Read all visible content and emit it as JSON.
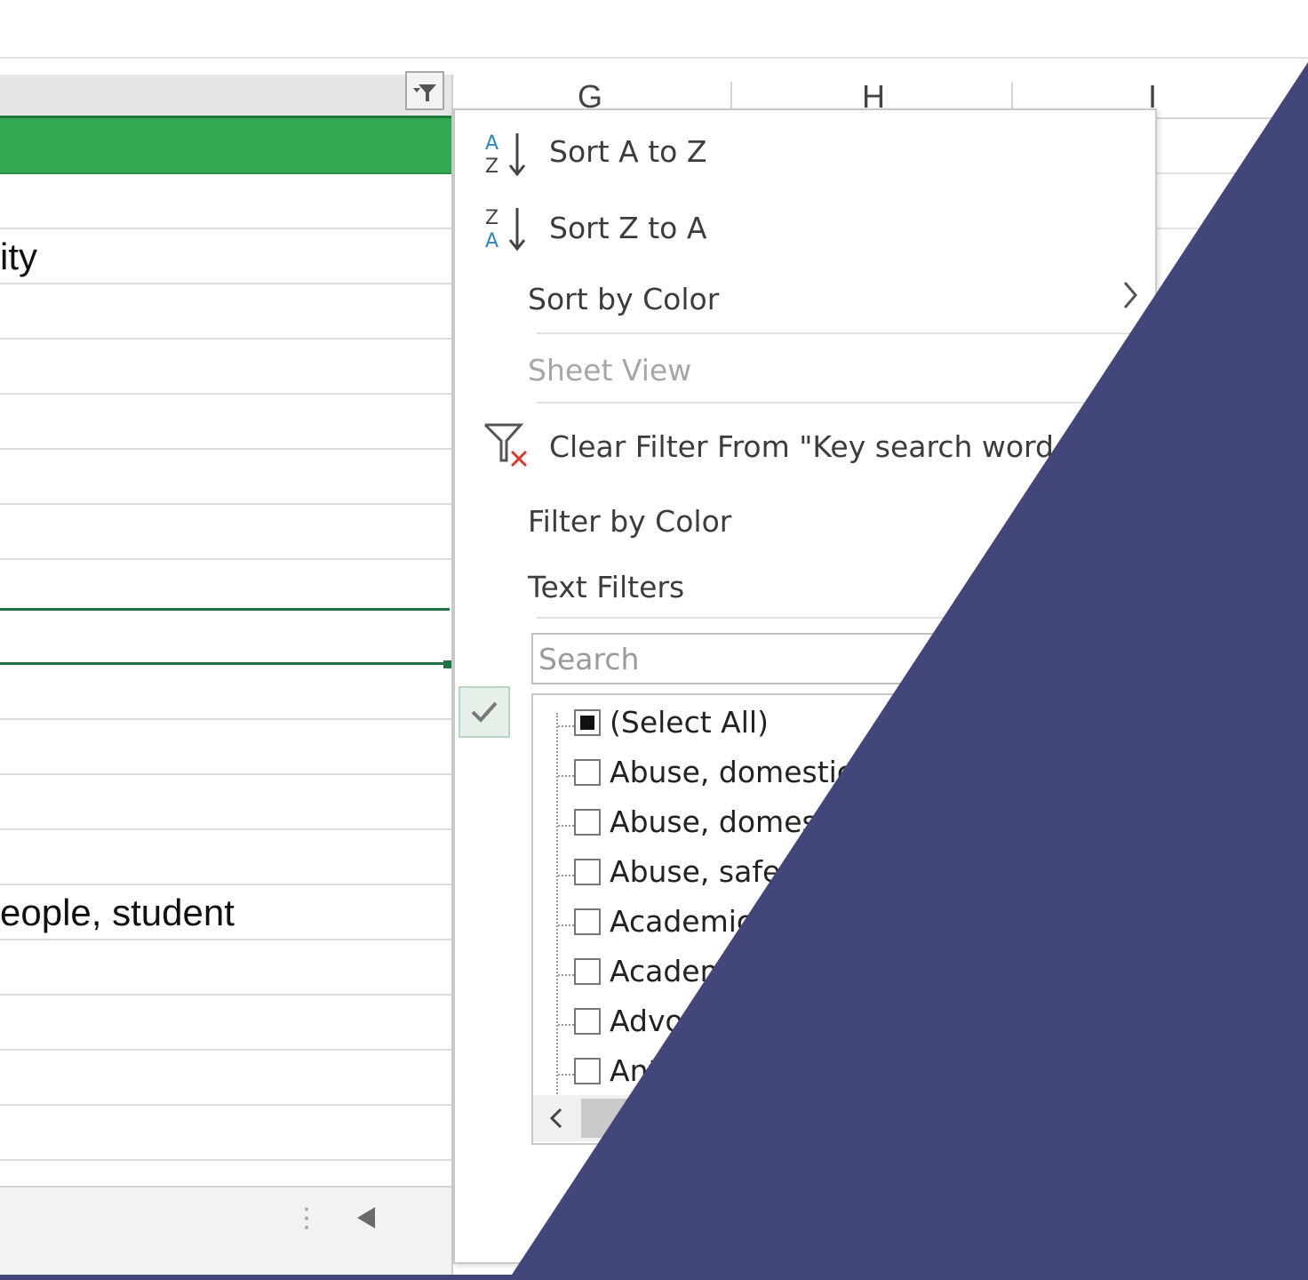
{
  "sheet": {
    "columns": [
      {
        "letter": "G"
      },
      {
        "letter": "H"
      },
      {
        "letter": "I"
      }
    ],
    "cells": {
      "row_ity": "ity",
      "row_student": "eople, student"
    }
  },
  "menu": {
    "sort_az": "Sort A to Z",
    "sort_za": "Sort Z to A",
    "sort_by_color": "Sort by Color",
    "sheet_view": "Sheet View",
    "clear_filter": "Clear Filter From \"Key search word f...",
    "filter_by_color": "Filter by Color",
    "text_filters": "Text Filters",
    "search_placeholder": "Search",
    "list_items": [
      {
        "label": "(Select All)",
        "state": "mixed"
      },
      {
        "label": "Abuse, domestic",
        "state": "unchecked"
      },
      {
        "label": "Abuse, domest",
        "state": "unchecked"
      },
      {
        "label": "Abuse, safeg",
        "state": "unchecked"
      },
      {
        "label": "Academic",
        "state": "unchecked"
      },
      {
        "label": "Academ",
        "state": "unchecked"
      },
      {
        "label": "Advo",
        "state": "unchecked"
      },
      {
        "label": "Ant",
        "state": "unchecked"
      }
    ]
  },
  "icons": {
    "sort_az": "sort-ascending-icon",
    "sort_za": "sort-descending-icon",
    "clear_filter": "clear-filter-icon",
    "filter_button": "filter-dropdown-icon",
    "submenu": "chevron-right-icon",
    "checkmark": "checkmark-icon",
    "scroll_left": "chevron-left-icon",
    "sheet_scroll_left": "triangle-left-icon"
  },
  "colors": {
    "header_fill": "#34a853",
    "selection_border": "#217346",
    "overlay": "#43467a",
    "sort_icon_blue": "#2e86c1",
    "clear_filter_red": "#e0392b"
  }
}
